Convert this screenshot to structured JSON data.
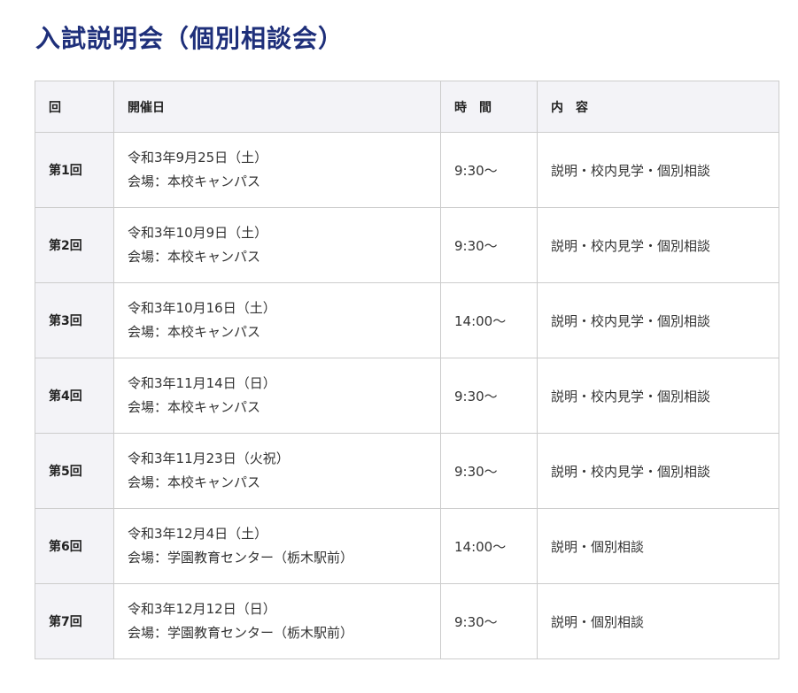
{
  "page": {
    "title": "入試説明会（個別相談会）"
  },
  "table": {
    "headers": {
      "round": "回",
      "date": "開催日",
      "time": "時　間",
      "content": "内　容"
    },
    "rows": [
      {
        "round": "第1回",
        "date": "令和3年9月25日（土）",
        "venue": "会場：本校キャンパス",
        "time": "9:30〜",
        "content": "説明・校内見学・個別相談"
      },
      {
        "round": "第2回",
        "date": "令和3年10月9日（土）",
        "venue": "会場：本校キャンパス",
        "time": "9:30〜",
        "content": "説明・校内見学・個別相談"
      },
      {
        "round": "第3回",
        "date": "令和3年10月16日（土）",
        "venue": "会場：本校キャンパス",
        "time": "14:00〜",
        "content": "説明・校内見学・個別相談"
      },
      {
        "round": "第4回",
        "date": "令和3年11月14日（日）",
        "venue": "会場：本校キャンパス",
        "time": "9:30〜",
        "content": "説明・校内見学・個別相談"
      },
      {
        "round": "第5回",
        "date": "令和3年11月23日（火祝）",
        "venue": "会場：本校キャンパス",
        "time": "9:30〜",
        "content": "説明・校内見学・個別相談"
      },
      {
        "round": "第6回",
        "date": "令和3年12月4日（土）",
        "venue": "会場：学園教育センター（栃木駅前）",
        "time": "14:00〜",
        "content": "説明・個別相談"
      },
      {
        "round": "第7回",
        "date": "令和3年12月12日（日）",
        "venue": "会場：学園教育センター（栃木駅前）",
        "time": "9:30〜",
        "content": "説明・個別相談"
      }
    ]
  },
  "colors": {
    "title": "#1e2f7a",
    "header_bg": "#f3f3f7",
    "border": "#cccccc"
  }
}
